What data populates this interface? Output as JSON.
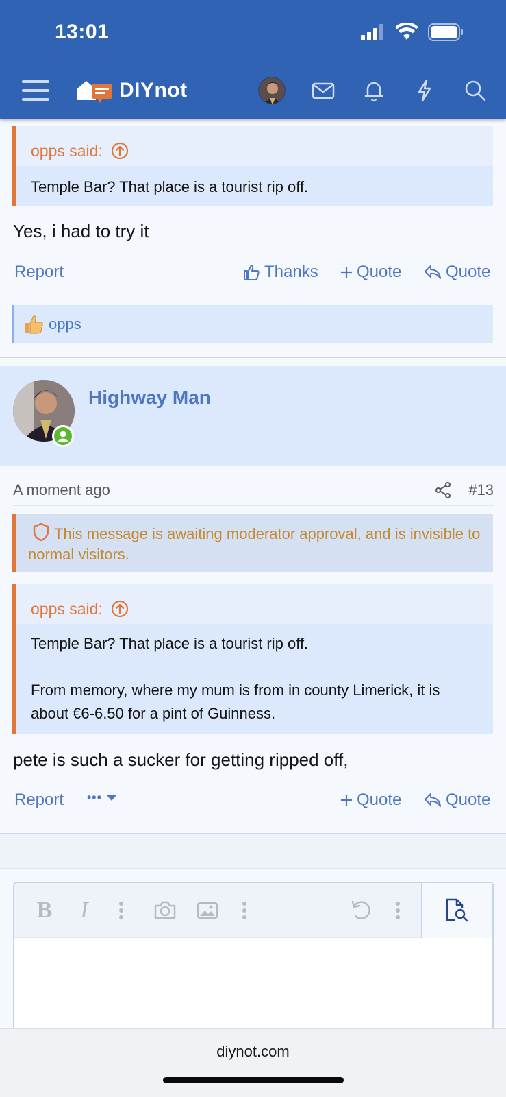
{
  "status_bar": {
    "time": "13:01"
  },
  "header": {
    "brand": "DIYnot",
    "icons": [
      "menu-icon",
      "avatar",
      "mail-icon",
      "bell-icon",
      "bolt-icon",
      "search-icon"
    ]
  },
  "post1": {
    "quote_author": "opps said:",
    "quote_text": "Temple Bar? That place is a tourist rip off.",
    "message": "Yes, i had to try it",
    "actions": {
      "report": "Report",
      "thanks": "Thanks",
      "plus_quote": "Quote",
      "quote": "Quote"
    },
    "reaction_user": "opps"
  },
  "post2": {
    "username": "Highway Man",
    "time": "A moment ago",
    "post_number": "#13",
    "moderation_notice": "This message is awaiting moderator approval, and is invisible to normal visitors.",
    "quote_author": "opps said:",
    "quote_line1": "Temple Bar? That place is a tourist rip off.",
    "quote_line2": "From memory, where my mum is from in county Limerick, it is about €6-6.50 for a pint of Guinness.",
    "message": "pete is such a sucker for getting ripped off,",
    "actions": {
      "report": "Report",
      "more": "•••",
      "plus_quote": "Quote",
      "quote": "Quote"
    }
  },
  "editor": {
    "toolbar": [
      "bold-icon",
      "italic-icon",
      "more-icon",
      "camera-icon",
      "image-icon",
      "more-icon",
      "undo-icon",
      "more-icon",
      "preview-icon"
    ]
  },
  "browser": {
    "url": "diynot.com"
  },
  "colors": {
    "header_blue": "#3163b5",
    "link_blue": "#4d76c3",
    "quote_orange": "#e0763a",
    "online_green": "#5cb82f"
  }
}
